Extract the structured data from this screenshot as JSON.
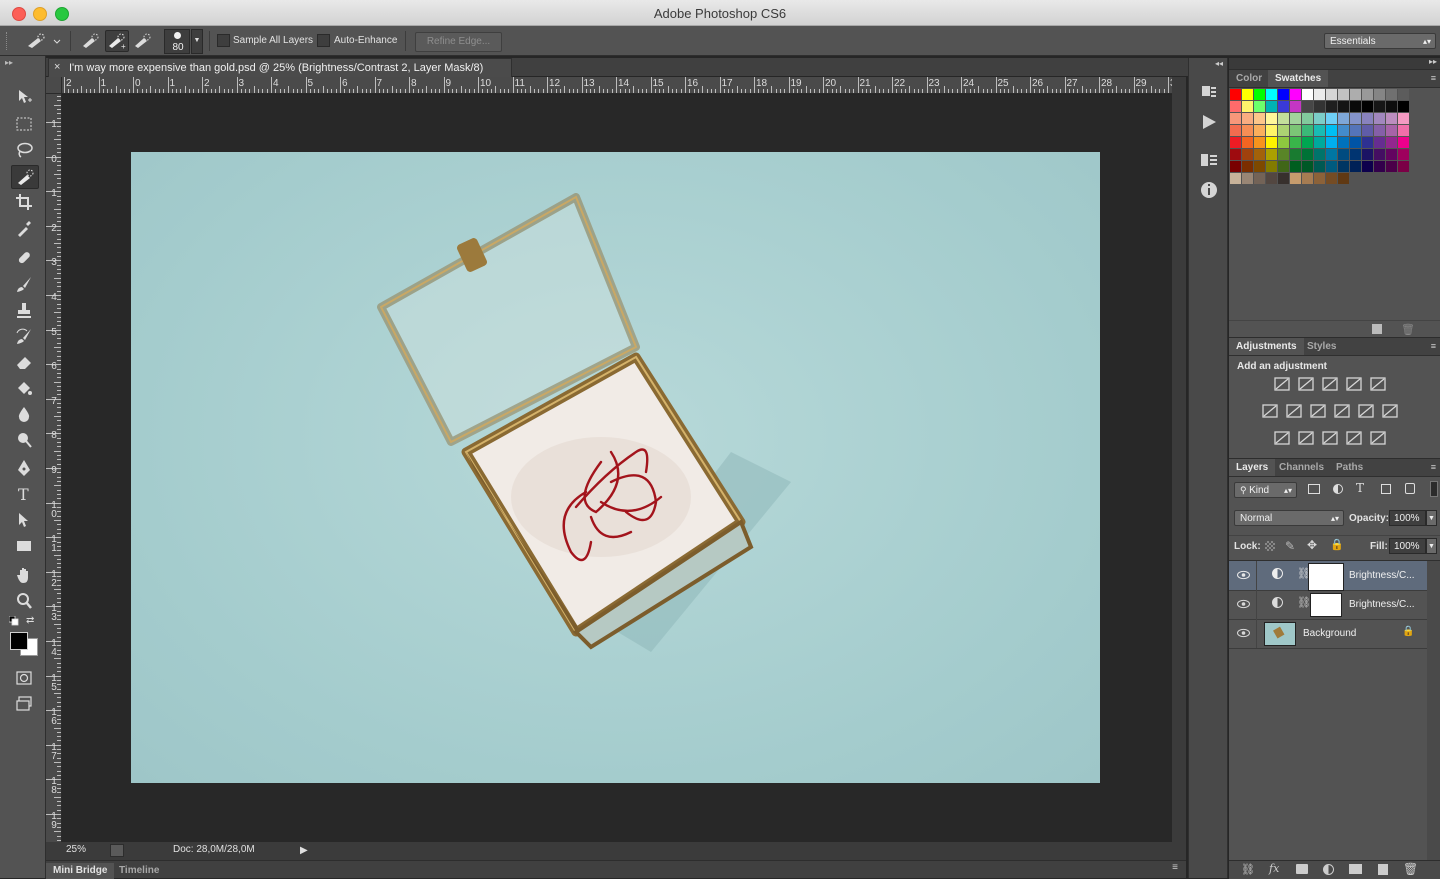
{
  "window": {
    "title": "Adobe Photoshop CS6"
  },
  "options_bar": {
    "brush_size": "80",
    "sample_all_layers": "Sample All Layers",
    "auto_enhance": "Auto-Enhance",
    "refine_edge": "Refine Edge...",
    "workspace": "Essentials"
  },
  "document": {
    "tab_title": "I'm way more expensive than gold.psd @ 25% (Brightness/Contrast 2, Layer Mask/8)",
    "close_glyph": "×"
  },
  "rulers": {
    "horizontal": [
      "2",
      "1",
      "0",
      "1",
      "2",
      "3",
      "4",
      "5",
      "6",
      "7",
      "8",
      "9",
      "10",
      "11",
      "12",
      "13",
      "14",
      "15",
      "16",
      "17",
      "18",
      "19",
      "20",
      "21",
      "22",
      "23",
      "24",
      "25",
      "26",
      "27",
      "28",
      "29",
      "3"
    ],
    "vertical": [
      "1",
      "0",
      "1",
      "2",
      "3",
      "4",
      "5",
      "6",
      "7",
      "8",
      "9",
      "10",
      "11",
      "12",
      "13",
      "14",
      "15",
      "16",
      "17",
      "18",
      "19"
    ]
  },
  "status": {
    "zoom": "25%",
    "doc_size": "Doc: 28,0M/28,0M"
  },
  "bottom_tabs": [
    "Mini Bridge",
    "Timeline"
  ],
  "color_panel": {
    "tabs": [
      "Color",
      "Swatches"
    ],
    "active": "Swatches",
    "swatch_rows": [
      [
        "#ff0000",
        "#ffff00",
        "#00ff00",
        "#00ffff",
        "#0000ff",
        "#ff00ff",
        "#ffffff",
        "#ebebeb",
        "#d6d6d6",
        "#c2c2c2",
        "#adadad",
        "#999999",
        "#858585",
        "#707070",
        "#5c5c5c"
      ],
      [
        "#ff6b6b",
        "#fff46b",
        "#6bff6b",
        "#00b3b3",
        "#3a3ad8",
        "#c436c4",
        "#474747",
        "#333333",
        "#1f1f1f",
        "#141414",
        "#0a0a0a",
        "#000000",
        "#161616",
        "#0d0d0d",
        "#000000"
      ],
      [
        "#f7977a",
        "#f9ad81",
        "#fdc68a",
        "#fff79a",
        "#c4df9b",
        "#a2d39c",
        "#82ca9d",
        "#7bcdc8",
        "#6ecff6",
        "#7ea7d8",
        "#8493ca",
        "#8882be",
        "#a187be",
        "#bc8dbf",
        "#f49ac2"
      ],
      [
        "#f26c4f",
        "#f68e55",
        "#fbaf5c",
        "#fff467",
        "#acd372",
        "#7cc576",
        "#3bb878",
        "#1abbb4",
        "#00bff3",
        "#438ccb",
        "#5574b9",
        "#605ca8",
        "#855fa8",
        "#a763a8",
        "#f06ea9"
      ],
      [
        "#ed1c24",
        "#f26522",
        "#f7941d",
        "#fff200",
        "#8dc73f",
        "#39b54a",
        "#00a651",
        "#00a99d",
        "#00aeef",
        "#0072bc",
        "#0054a6",
        "#2e3192",
        "#662d91",
        "#92278f",
        "#ec008c"
      ],
      [
        "#9e0b0f",
        "#a0410d",
        "#a3620a",
        "#aba000",
        "#598527",
        "#197b30",
        "#007236",
        "#00746b",
        "#0076a3",
        "#004b80",
        "#003471",
        "#1b1464",
        "#440e62",
        "#630460",
        "#9e005d"
      ],
      [
        "#790000",
        "#7b2e00",
        "#7d4900",
        "#827b00",
        "#406618",
        "#005e20",
        "#005826",
        "#005952",
        "#005b7f",
        "#003663",
        "#002157",
        "#0d004c",
        "#32004b",
        "#4b0049",
        "#7b0046"
      ],
      [
        "#c7b299",
        "#998675",
        "#736357",
        "#534741",
        "#37302d",
        "#c69c6d",
        "#a67c52",
        "#8c6239",
        "#754c24",
        "#603913"
      ]
    ]
  },
  "adjustments_panel": {
    "tabs": [
      "Adjustments",
      "Styles"
    ],
    "heading": "Add an adjustment",
    "icons": [
      [
        "brightness-contrast-icon",
        "levels-icon",
        "curves-icon",
        "exposure-icon",
        "vibrance-icon"
      ],
      [
        "hue-saturation-icon",
        "color-balance-icon",
        "black-white-icon",
        "photo-filter-icon",
        "channel-mixer-icon",
        "color-lookup-icon"
      ],
      [
        "invert-icon",
        "posterize-icon",
        "threshold-icon",
        "selective-color-icon",
        "gradient-map-icon"
      ]
    ]
  },
  "layers_panel": {
    "tabs": [
      "Layers",
      "Channels",
      "Paths"
    ],
    "kind_label": "Kind",
    "blend_mode": "Normal",
    "opacity_label": "Opacity:",
    "opacity_value": "100%",
    "lock_label": "Lock:",
    "fill_label": "Fill:",
    "fill_value": "100%",
    "layers": [
      {
        "name": "Brightness/C...",
        "type": "adjustment",
        "selected": true
      },
      {
        "name": "Brightness/C...",
        "type": "adjustment",
        "selected": false
      },
      {
        "name": "Background",
        "type": "image",
        "selected": false,
        "locked": true
      }
    ]
  },
  "colors": {
    "ui_dark": "#535353",
    "canvas_bg": "#282828",
    "photo_bg": "#a9d0d1",
    "selected_layer": "#5f6b7c"
  }
}
